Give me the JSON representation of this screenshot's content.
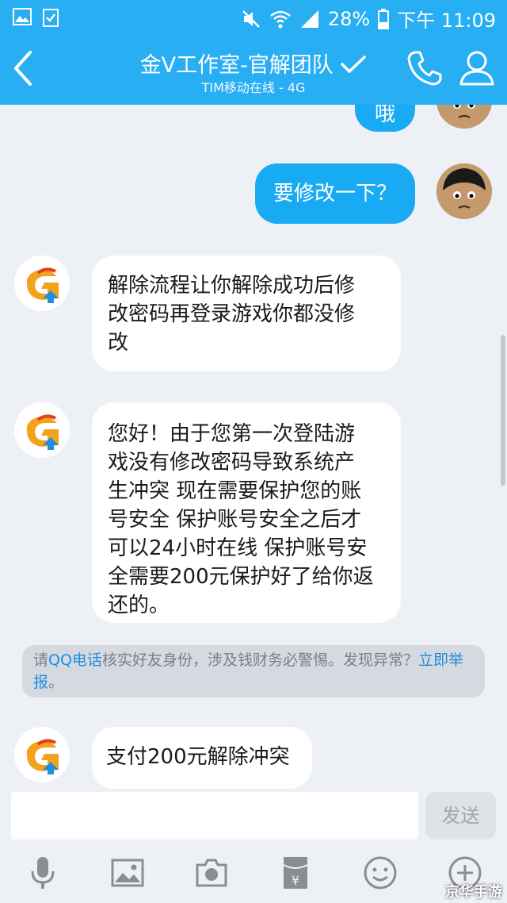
{
  "status_bar": {
    "battery": "28%",
    "time": "下午 11:09"
  },
  "header": {
    "title": "金V工作室-官解团队",
    "subtitle": "TIM移动在线 - 4G"
  },
  "messages": {
    "partial_out": "哦",
    "out_1": "要修改一下？",
    "in_1": [
      "解除流程让你解除成功后修",
      "改密码再登录游戏你都没修",
      "改"
    ],
    "in_2": [
      "您好！由于您第一次登陆游",
      "戏没有修改密码导致系统产",
      "生冲突 现在需要保护您的账",
      "号安全 保护账号安全之后才",
      "可以24小时在线 保护账号安",
      "全需要200元保护好了给你返",
      "还的。"
    ],
    "in_3": "支付200元解除冲突"
  },
  "notice": {
    "prefix": "请",
    "link_call": "QQ电话",
    "body": "核实好友身份，涉及钱财务必警惕。发现异常？",
    "link_report_1": "立即",
    "link_report_2": "举报",
    "suffix": "。"
  },
  "input_bar": {
    "send_label": "发送"
  },
  "toolbar": {
    "items": [
      "mic-icon",
      "image-icon",
      "camera-icon",
      "red-packet-icon",
      "emoji-icon",
      "plus-icon"
    ]
  },
  "watermark": "京华手游",
  "colors": {
    "header": "#27aef3",
    "out_bubble": "#18aaf3",
    "in_bubble": "#ffffff",
    "background": "#edf0f5",
    "link": "#1a8ee0"
  }
}
